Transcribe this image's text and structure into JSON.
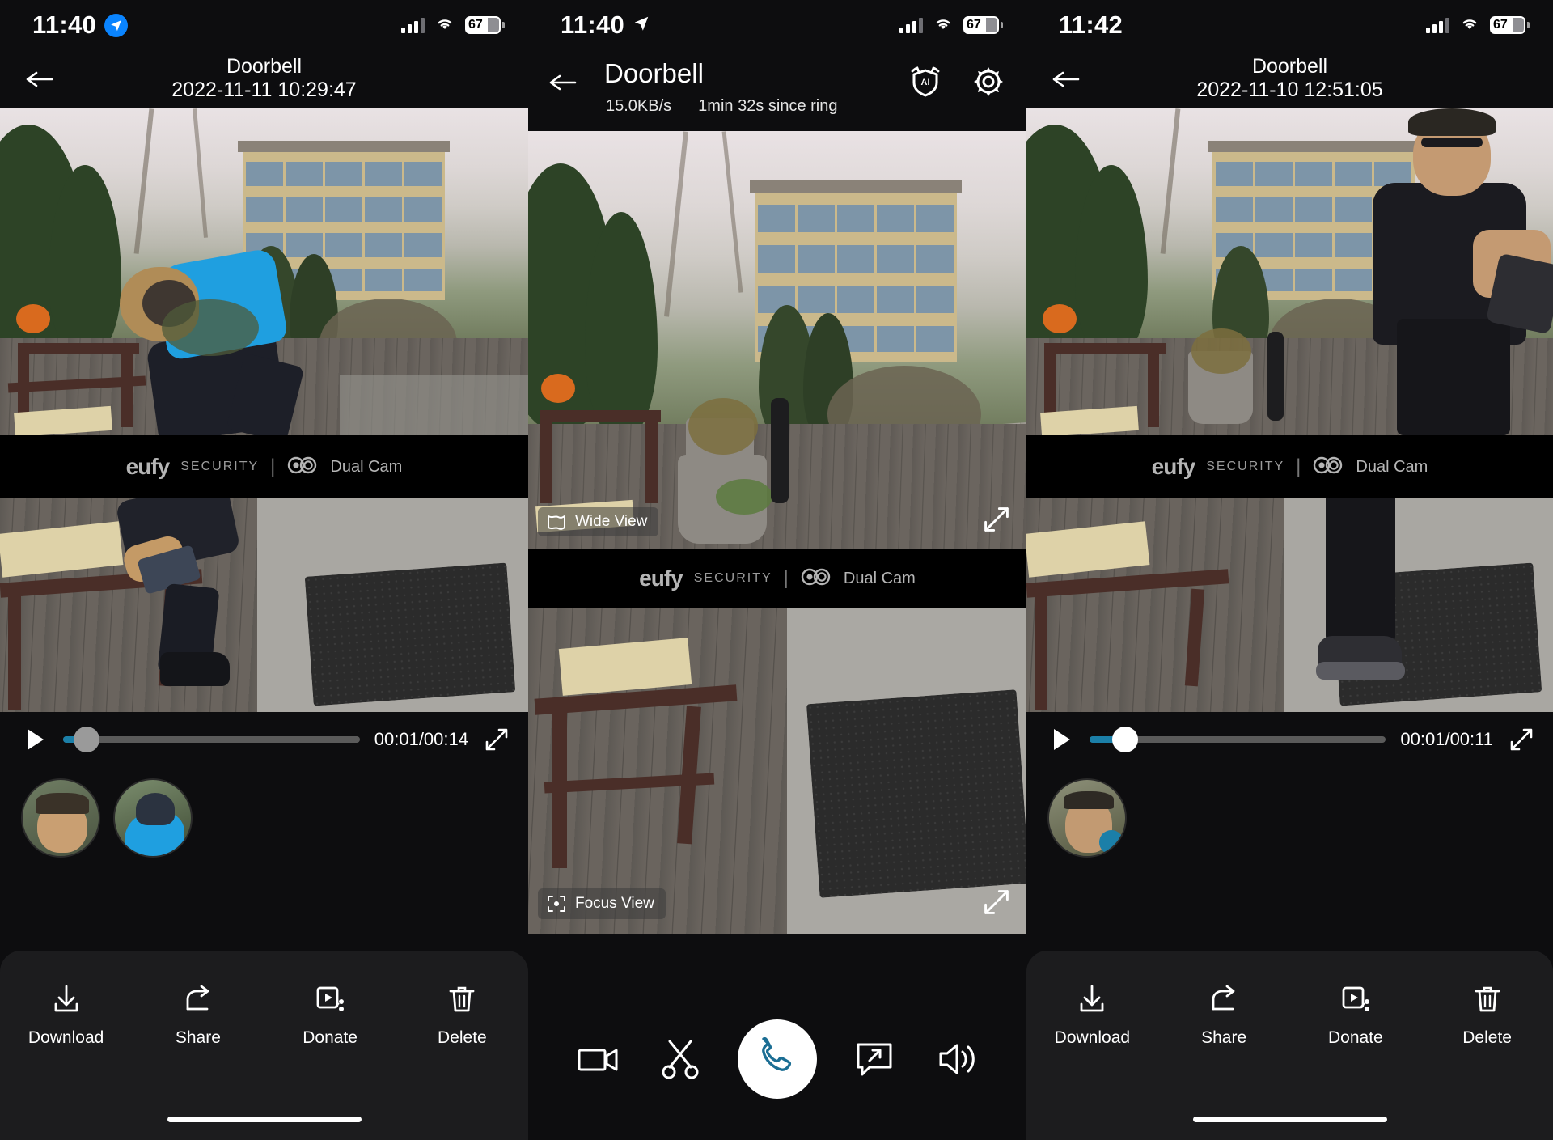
{
  "panels": [
    {
      "id": "recording-left",
      "status": {
        "time": "11:40",
        "location_icon": "location-arrow-icon",
        "signal_icon": "cellular-bars-icon",
        "wifi_icon": "wifi-icon",
        "battery": "67"
      },
      "nav": {
        "back_icon": "back-arrow-icon",
        "title": "Doorbell",
        "subtitle": "2022-11-11 10:29:47"
      },
      "watermark": {
        "brand": "eufy",
        "brand_sub": "SECURITY",
        "divider": "|",
        "cam_icon": "dual-cam-icon",
        "cam_label": "Dual Cam"
      },
      "player": {
        "play_icon": "play-icon",
        "current": "00:01",
        "total": "00:14",
        "time_label": "00:01/00:14",
        "progress_pct": 8,
        "fullscreen_icon": "fullscreen-icon"
      },
      "thumbnails": [
        {
          "name": "face-thumbnail-1"
        },
        {
          "name": "face-thumbnail-2"
        }
      ],
      "actions": [
        {
          "icon": "download-icon",
          "label": "Download"
        },
        {
          "icon": "share-icon",
          "label": "Share"
        },
        {
          "icon": "donate-icon",
          "label": "Donate"
        },
        {
          "icon": "delete-icon",
          "label": "Delete"
        }
      ],
      "home_indicator": true
    },
    {
      "id": "live-center",
      "status": {
        "time": "11:40",
        "location_icon": "location-arrow-icon",
        "signal_icon": "cellular-bars-icon",
        "wifi_icon": "wifi-icon",
        "battery": "67"
      },
      "nav": {
        "back_icon": "back-arrow-icon",
        "title": "Doorbell",
        "bitrate": "15.0KB/s",
        "since_ring": "1min 32s since ring",
        "ai_icon": "ai-shield-icon",
        "settings_icon": "gear-icon"
      },
      "wide_view": {
        "icon": "wide-view-icon",
        "label": "Wide View",
        "expand_icon": "expand-icon"
      },
      "focus_view": {
        "icon": "focus-view-icon",
        "label": "Focus View",
        "expand_icon": "expand-icon"
      },
      "watermark": {
        "brand": "eufy",
        "brand_sub": "SECURITY",
        "divider": "|",
        "cam_icon": "dual-cam-icon",
        "cam_label": "Dual Cam"
      },
      "call_controls": [
        {
          "icon": "video-record-icon",
          "name": "record-button"
        },
        {
          "icon": "scissors-icon",
          "name": "snapshot-button"
        },
        {
          "icon": "phone-icon",
          "name": "answer-call-button",
          "accent": "#1b6e94"
        },
        {
          "icon": "quick-response-icon",
          "name": "quick-response-button"
        },
        {
          "icon": "speaker-icon",
          "name": "speaker-button"
        }
      ]
    },
    {
      "id": "recording-right",
      "status": {
        "time": "11:42",
        "location_icon": "none",
        "signal_icon": "cellular-bars-icon",
        "wifi_icon": "wifi-icon",
        "battery": "67"
      },
      "nav": {
        "back_icon": "back-arrow-icon",
        "title": "Doorbell",
        "subtitle": "2022-11-10 12:51:05"
      },
      "watermark": {
        "brand": "eufy",
        "brand_sub": "SECURITY",
        "divider": "|",
        "cam_icon": "dual-cam-icon",
        "cam_label": "Dual Cam"
      },
      "player": {
        "play_icon": "play-icon",
        "current": "00:01",
        "total": "00:11",
        "time_label": "00:01/00:11",
        "progress_pct": 12,
        "fullscreen_icon": "fullscreen-icon"
      },
      "thumbnails": [
        {
          "name": "face-thumbnail-1"
        }
      ],
      "actions": [
        {
          "icon": "download-icon",
          "label": "Download"
        },
        {
          "icon": "share-icon",
          "label": "Share"
        },
        {
          "icon": "donate-icon",
          "label": "Donate"
        },
        {
          "icon": "delete-icon",
          "label": "Delete"
        }
      ],
      "home_indicator": true
    }
  ],
  "colors": {
    "accent_blue": "#0a84ff",
    "progress": "#1b7fa8",
    "sheet_bg": "#1c1c1e",
    "app_bg": "#0d0d0f",
    "phone_teal": "#1b6e94"
  }
}
